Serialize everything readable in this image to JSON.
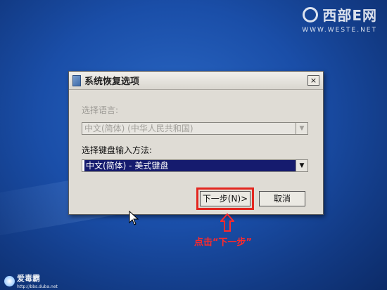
{
  "watermark_top": {
    "brand": "西部E网",
    "url": "WWW.WESTE.NET"
  },
  "dialog": {
    "title": "系统恢复选项",
    "close_glyph": "×",
    "language_label": "选择语言:",
    "language_value": "中文(简体) (中华人民共和国)",
    "keyboard_label": "选择键盘输入方法:",
    "keyboard_value": "中文(简体) - 美式键盘",
    "next_button": "下一步(N)>",
    "cancel_button": "取消"
  },
  "annotation": {
    "text": "点击“下一步”",
    "color": "#ff2a2a"
  },
  "watermark_bottom": {
    "name": "爱毒霸",
    "url": "http://bbs.duba.net"
  }
}
